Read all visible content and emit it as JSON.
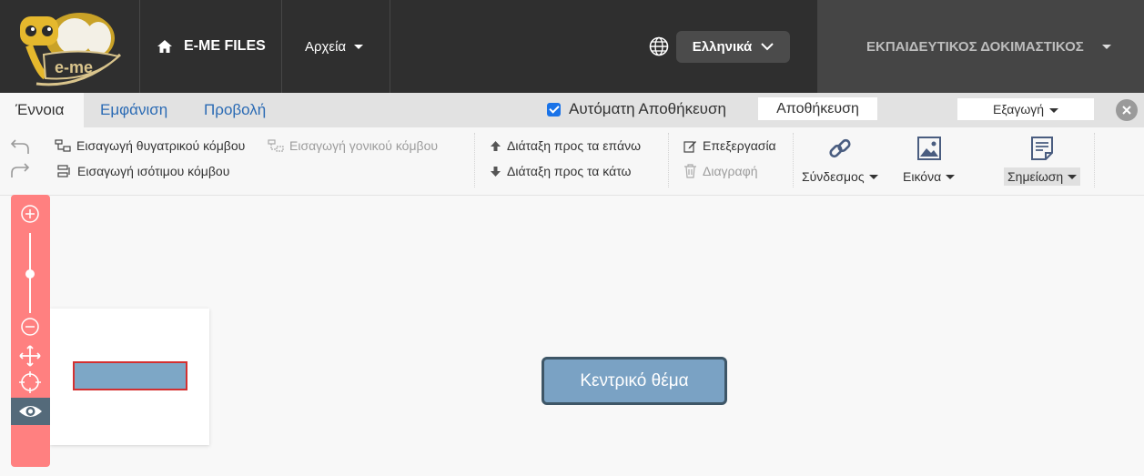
{
  "header": {
    "logo_text": "e-me",
    "home_label": "E-ME FILES",
    "files_menu_label": "Αρχεία",
    "language_label": "Ελληνικά",
    "user_name": "ΕΚΠΑΙΔΕΥΤΙΚΟΣ ΔΟΚΙΜΑΣΤΙΚΟΣ"
  },
  "tabs": [
    {
      "label": "Έννοια",
      "active": true
    },
    {
      "label": "Εμφάνιση",
      "active": false
    },
    {
      "label": "Προβολή",
      "active": false
    }
  ],
  "autosave": {
    "label": "Αυτόματη Αποθήκευση",
    "checked": true
  },
  "save_label": "Αποθήκευση",
  "export_label": "Εξαγωγή",
  "toolbar": {
    "insert_child": "Εισαγωγή θυγατρικού κόμβου",
    "insert_parent": "Εισαγωγή γονικού κόμβου",
    "insert_sibling": "Εισαγωγή ισότιμου κόμβου",
    "move_up": "Διάταξη προς τα επάνω",
    "move_down": "Διάταξη προς τα κάτω",
    "edit": "Επεξεργασία",
    "delete": "Διαγραφή",
    "link": "Σύνδεσμος",
    "image": "Εικόνα",
    "note": "Σημείωση"
  },
  "canvas": {
    "central_topic": "Κεντρικό θέμα"
  },
  "colors": {
    "header_bg": "#2f2f2f",
    "accent_blue": "#2a6ab4",
    "zoom_panel": "#ff8080",
    "node_fill": "#7aa2c4",
    "node_border": "#3e5667"
  }
}
